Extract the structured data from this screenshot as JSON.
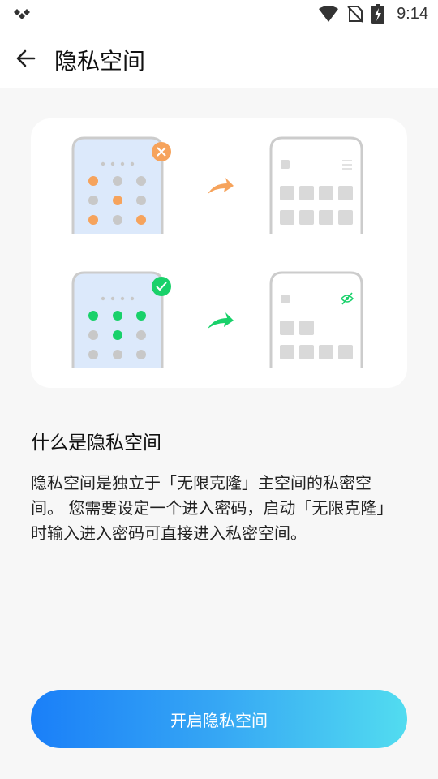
{
  "status_bar": {
    "time": "9:14",
    "icons": [
      "app-logo-icon",
      "wifi-icon",
      "no-sim-icon",
      "battery-charging-icon"
    ]
  },
  "toolbar": {
    "back_icon": "arrow-left-icon",
    "title": "隐私空间"
  },
  "illustration": {
    "rows": [
      {
        "lock_state": "error",
        "badge_icon": "x-icon",
        "accent": "#f6a35c",
        "arrow_icon": "curved-arrow-icon",
        "result_icon": "menu-icon"
      },
      {
        "lock_state": "success",
        "badge_icon": "check-icon",
        "accent": "#19d16a",
        "arrow_icon": "curved-arrow-icon",
        "result_icon": "eye-off-icon"
      }
    ]
  },
  "info": {
    "heading": "什么是隐私空间",
    "body": "隐私空间是独立于「无限克隆」主空间的私密空间。 您需要设定一个进入密码，启动「无限克隆」时输入进入密码可直接进入私密空间。"
  },
  "action": {
    "enable_label": "开启隐私空间"
  },
  "colors": {
    "primary_gradient_start": "#1a7ff8",
    "primary_gradient_end": "#52dcf0",
    "error": "#f6a35c",
    "success": "#19d16a",
    "phone_screen": "#dce9fb"
  }
}
